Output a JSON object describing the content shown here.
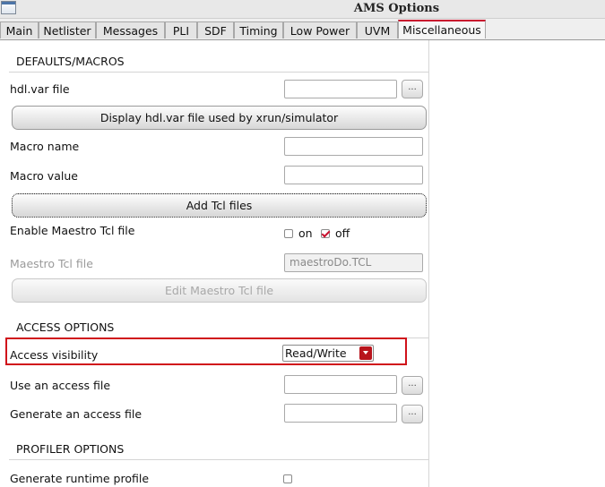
{
  "window": {
    "title": "AMS Options"
  },
  "tabs": [
    {
      "label": "Main"
    },
    {
      "label": "Netlister"
    },
    {
      "label": "Messages"
    },
    {
      "label": "PLI"
    },
    {
      "label": "SDF"
    },
    {
      "label": "Timing"
    },
    {
      "label": "Low Power"
    },
    {
      "label": "UVM"
    },
    {
      "label": "Miscellaneous"
    }
  ],
  "active_tab": "Miscellaneous",
  "defaults": {
    "heading": "DEFAULTS/MACROS",
    "hdl_var_label": "hdl.var file",
    "hdl_var_value": "",
    "browse_label": "...",
    "display_button": "Display hdl.var file used by xrun/simulator",
    "macro_name_label": "Macro name",
    "macro_name_value": "",
    "macro_value_label": "Macro value",
    "macro_value_value": "",
    "add_tcl_button": "Add Tcl files",
    "enable_maestro_label": "Enable Maestro Tcl file",
    "on_label": "on",
    "off_label": "off",
    "on_checked": false,
    "off_checked": true,
    "maestro_tcl_label": "Maestro Tcl file",
    "maestro_tcl_value": "maestroDo.TCL",
    "edit_maestro_button": "Edit Maestro Tcl file"
  },
  "access": {
    "heading": "ACCESS OPTIONS",
    "visibility_label": "Access visibility",
    "visibility_value": "Read/Write",
    "use_file_label": "Use an access file",
    "use_file_value": "",
    "generate_file_label": "Generate an access file",
    "generate_file_value": ""
  },
  "profiler": {
    "heading": "PROFILER OPTIONS",
    "runtime_profile_label": "Generate runtime profile",
    "runtime_profile_checked": false
  },
  "colors": {
    "accent": "#c8102e",
    "highlight_border": "#d0121b"
  }
}
